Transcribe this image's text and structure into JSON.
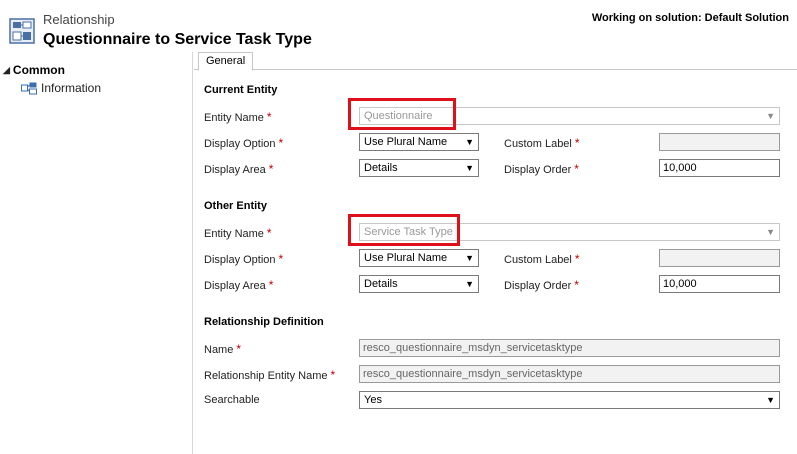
{
  "header": {
    "breadcrumb": "Relationship",
    "title": "Questionnaire to Service Task Type",
    "solution": "Working on solution: Default Solution"
  },
  "sidebar": {
    "group": "Common",
    "items": [
      {
        "label": "Information",
        "icon": "information-icon"
      }
    ]
  },
  "tabs": [
    {
      "label": "General",
      "active": true
    }
  ],
  "required_marker": "*",
  "sections": {
    "current": {
      "title": "Current Entity",
      "entity_name_label": "Entity Name",
      "entity_name_value": "Questionnaire",
      "display_option_label": "Display Option",
      "display_option_value": "Use Plural Name",
      "custom_label_label": "Custom Label",
      "custom_label_value": "",
      "display_area_label": "Display Area",
      "display_area_value": "Details",
      "display_order_label": "Display Order",
      "display_order_value": "10,000"
    },
    "other": {
      "title": "Other Entity",
      "entity_name_label": "Entity Name",
      "entity_name_value": "Service Task Type",
      "display_option_label": "Display Option",
      "display_option_value": "Use Plural Name",
      "custom_label_label": "Custom Label",
      "custom_label_value": "",
      "display_area_label": "Display Area",
      "display_area_value": "Details",
      "display_order_label": "Display Order",
      "display_order_value": "10,000"
    },
    "definition": {
      "title": "Relationship Definition",
      "name_label": "Name",
      "name_value": "resco_questionnaire_msdyn_servicetasktype",
      "rel_entity_label": "Relationship Entity Name",
      "rel_entity_value": "resco_questionnaire_msdyn_servicetasktype",
      "searchable_label": "Searchable",
      "searchable_value": "Yes"
    }
  },
  "colors": {
    "highlight": "#e0101a",
    "required": "#c00000"
  }
}
